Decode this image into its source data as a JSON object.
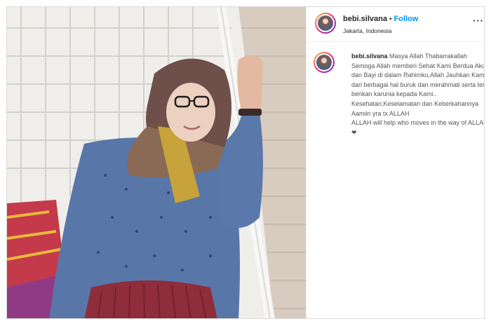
{
  "post": {
    "username": "bebi.silvana",
    "separator": "•",
    "follow_label": "Follow",
    "location": "Jakarta, Indonesia",
    "more_icon": "more-options-icon",
    "more_glyph": "···",
    "photo_description_icon": "post-photo"
  },
  "caption": {
    "username": "bebi.silvana",
    "text": "Masya Allah Thabarrakallah Semoga Allah memberi Sehat Kami Berdua Aku dan Bayi di dalam Rahimku,Allah Jauhkan Kami dari berbagai hal buruk dan merahmati serta terus berikan karunia kepada Kami.. Kesehatan,Keselamatan dan Keberkahannya Aamiin yra tx ALLAH\nALLAH will help who moves in the way of ALLAH.❤"
  },
  "colors": {
    "follow": "#0095f6",
    "border": "#dbdbdb"
  }
}
